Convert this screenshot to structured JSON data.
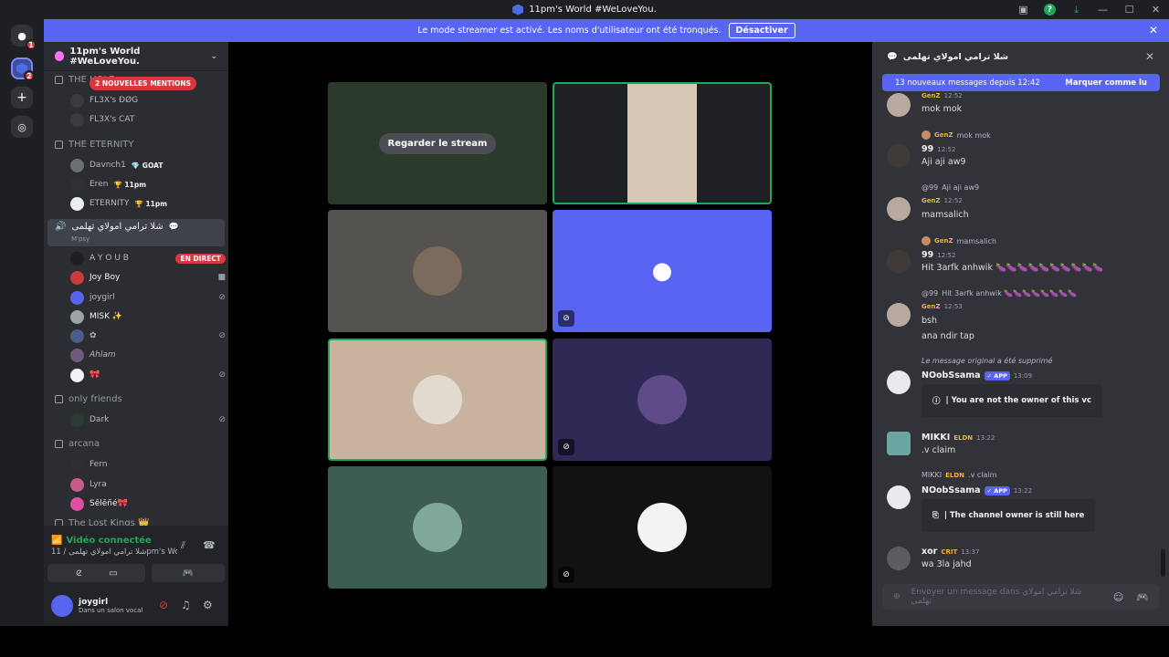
{
  "window": {
    "title": "11pm's World #WeLoveYou."
  },
  "streamer": {
    "notice": "Le mode streamer est activé. Les noms d'utilisateur ont été tronqués.",
    "button": "Désactiver"
  },
  "guilds": {
    "badge_dm": "1",
    "badge_server": "2"
  },
  "server": {
    "name": "11pm's World #WeLoveYou.",
    "mentions_pill": "2 NOUVELLES MENTIONS",
    "categories": [
      {
        "label": "THE HOLE",
        "users": [
          {
            "name": "FL3X's ĐØG"
          },
          {
            "name": "FL3X's CAT"
          }
        ]
      },
      {
        "label": "THE ETERNITY",
        "users": [
          {
            "name": "Davnch1",
            "tag": "💎 GOAT"
          },
          {
            "name": "Eren",
            "tag": "🏆 11pm"
          },
          {
            "name": "ETERNITY",
            "tag": "🏆 11pm"
          }
        ]
      }
    ],
    "active_channel": {
      "name": "شلا ترامي امولاي تهلمى",
      "sub": "M'psy"
    },
    "channel_users": [
      {
        "name": "A Y O U B",
        "status": "EN DIRECT"
      },
      {
        "name": "Joy Boy"
      },
      {
        "name": "joygirl"
      },
      {
        "name": "MISK ✨"
      },
      {
        "name": "✿"
      },
      {
        "name": "Ahlam"
      },
      {
        "name": "🎀"
      }
    ],
    "only_friends": {
      "label": "only friends",
      "users": [
        {
          "name": "Dark"
        }
      ]
    },
    "arcana": {
      "label": "arcana",
      "users": [
        {
          "name": "Fern"
        },
        {
          "name": "Lyra"
        },
        {
          "name": "Sêlēñé🎀"
        }
      ]
    },
    "last": {
      "label": "The Lost Kings 👑"
    }
  },
  "voice": {
    "connected": "Vidéo connectée",
    "channel": "شلا ترامي امولاي تهلمى / 11pm's World #WeLove...",
    "user": "joygirl",
    "status": "Dans un salon vocal"
  },
  "stage": {
    "stream_button": "Regarder le stream"
  },
  "chat": {
    "channel": "شلا ترامي امولاي تهلمى",
    "new_messages": "13 nouveaux messages depuis 12:42",
    "mark_read": "Marquer comme lu",
    "placeholder": "Envoyer un message dans شلا ترامي امولاي تهلمى",
    "messages": [
      {
        "tag": "GenZ",
        "time": "12:52",
        "text": "mok mok"
      },
      {
        "reply_text": "mok mok",
        "reply_tag": "GenZ",
        "name": "99",
        "time": "12:52",
        "text": "Aji aji aw9"
      },
      {
        "reply_name": "@99",
        "reply_text": "Aji aji aw9",
        "tag": "GenZ",
        "time": "12:52",
        "text": "mamsalich"
      },
      {
        "reply_text": "mamsalich",
        "reply_tag": "GenZ",
        "name": "99",
        "time": "12:52",
        "text": "Hit 3arfk anhwik 🍆🍆🍆🍆🍆🍆🍆🍆🍆🍆"
      },
      {
        "reply_name": "@99",
        "reply_text": "Hit 3arfk anhwik 🍆🍆🍆🍆🍆🍆🍆🍆",
        "tag": "GenZ",
        "time": "12:53",
        "text": "bsh",
        "text2": "ana ndir tap"
      },
      {
        "reply_text": "Le message original a été supprimé",
        "name": "NOobSsama",
        "app": "✓ APP",
        "time": "13:09",
        "embed": "| You are not the owner of this vc"
      },
      {
        "name": "MIKKI",
        "tag": "ELDN",
        "time": "13:22",
        "text": ".v claim"
      },
      {
        "reply_name": "MIKKI",
        "reply_tag": "ELDN",
        "reply_text": ".v claim",
        "name": "NOobSsama",
        "app": "✓ APP",
        "time": "13:22",
        "embed": "| The channel owner is still here"
      },
      {
        "name": "xor",
        "tag": "CRIT",
        "time": "13:37",
        "text": "wa 3la jahd"
      }
    ]
  },
  "colors": {
    "accent": "#5865f2",
    "live": "#da373c",
    "green": "#23a55a"
  }
}
